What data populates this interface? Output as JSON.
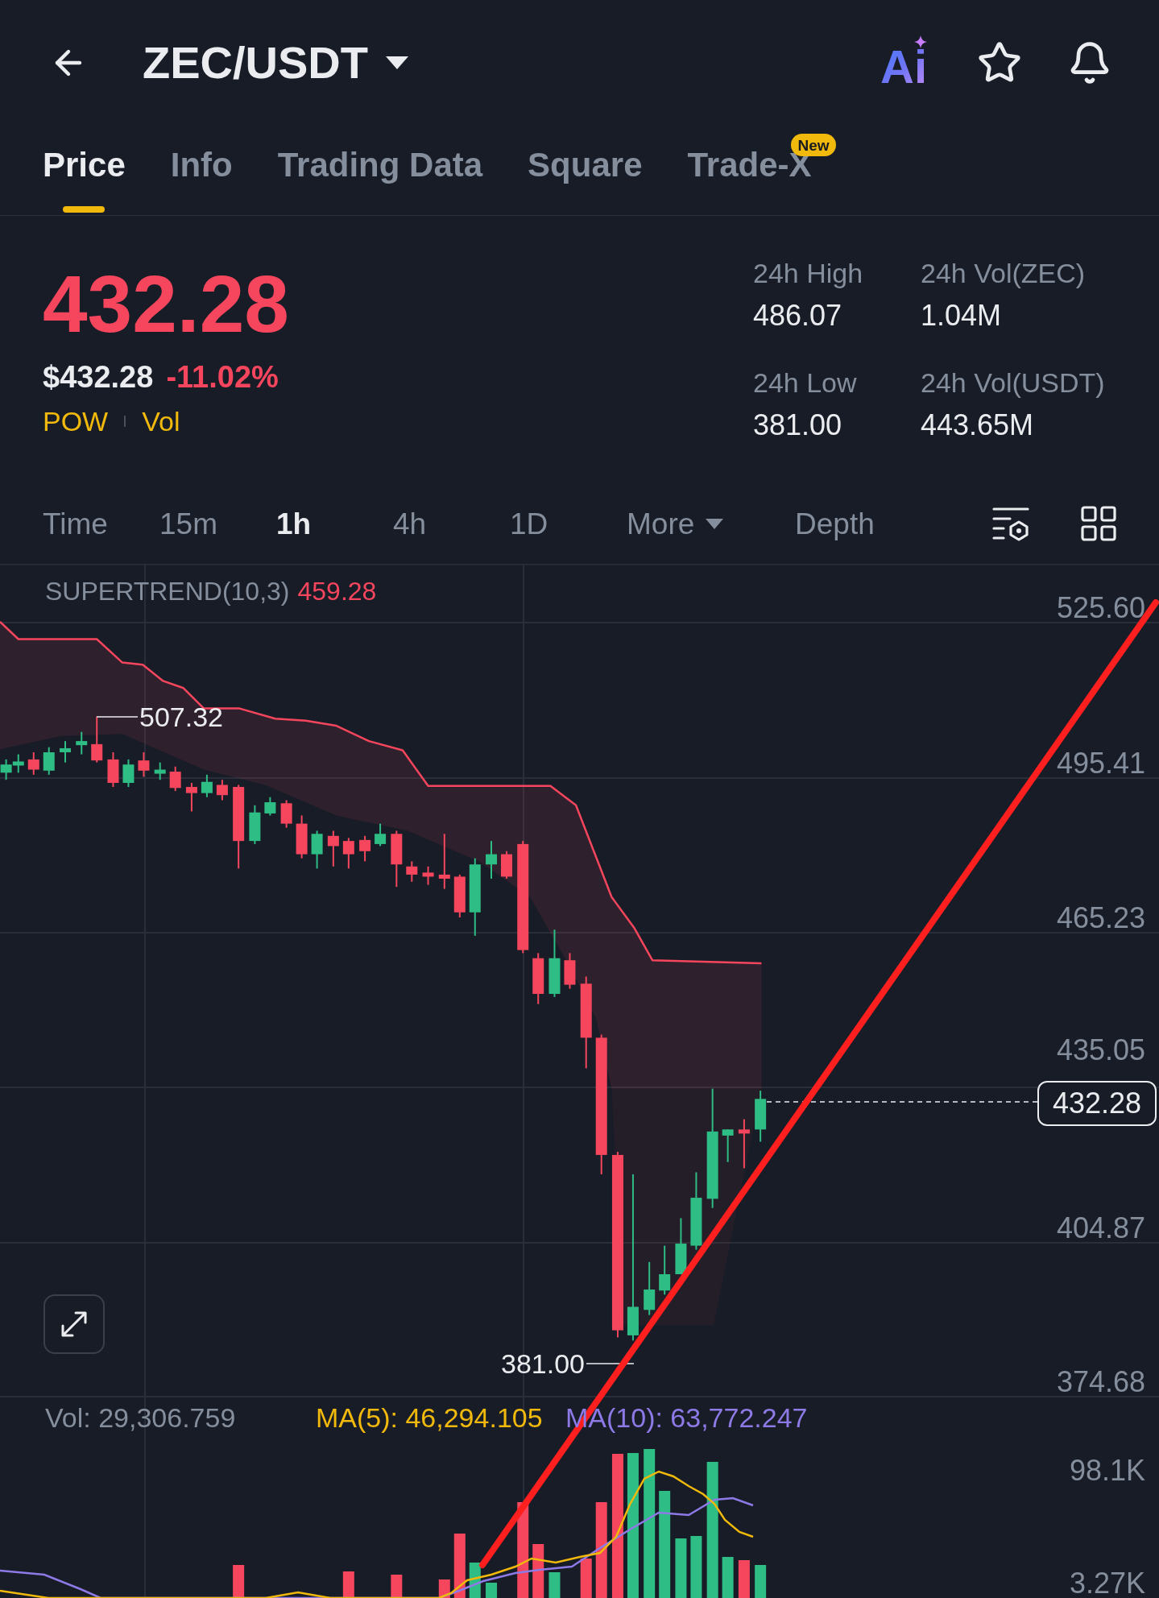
{
  "header": {
    "title": "ZEC/USDT",
    "ai_label": "Ai"
  },
  "tabs": [
    {
      "label": "Price",
      "selected": true
    },
    {
      "label": "Info",
      "selected": false
    },
    {
      "label": "Trading Data",
      "selected": false
    },
    {
      "label": "Square",
      "selected": false
    },
    {
      "label": "Trade-X",
      "selected": false,
      "badge": "New"
    }
  ],
  "ticker": {
    "last_price": "432.28",
    "usd_price": "$432.28",
    "change": "-11.02%",
    "tags": [
      "POW",
      "Vol"
    ],
    "stats": [
      {
        "label": "24h High",
        "value": "486.07"
      },
      {
        "label": "24h Vol(ZEC)",
        "value": "1.04M"
      },
      {
        "label": "24h Low",
        "value": "381.00"
      },
      {
        "label": "24h Vol(USDT)",
        "value": "443.65M"
      }
    ]
  },
  "intervals": [
    {
      "label": "Time",
      "kind": "option",
      "selected": false
    },
    {
      "label": "15m",
      "kind": "option",
      "selected": false
    },
    {
      "label": "1h",
      "kind": "option",
      "selected": true
    },
    {
      "label": "4h",
      "kind": "option",
      "selected": false
    },
    {
      "label": "1D",
      "kind": "option",
      "selected": false
    },
    {
      "label": "More",
      "kind": "dropdown",
      "selected": false
    },
    {
      "label": "Depth",
      "kind": "option",
      "selected": false
    }
  ],
  "chart": {
    "indicator": {
      "name": "SUPERTREND(10,3)",
      "value": "459.28"
    },
    "price_axis": [
      "525.60",
      "495.41",
      "465.23",
      "435.05",
      "404.87",
      "374.68"
    ],
    "high_label": "507.32",
    "low_label": "381.00",
    "current_price": "432.28",
    "volume": {
      "vol": "Vol: 29,306.759",
      "ma5": "MA(5): 46,294.105",
      "ma10": "MA(10): 63,772.247",
      "axis": [
        "98.1K",
        "3.27K"
      ]
    }
  }
}
